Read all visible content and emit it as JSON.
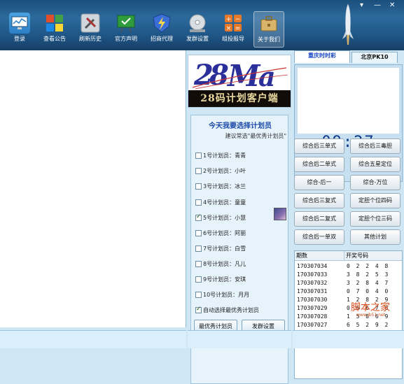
{
  "window_controls": {
    "menu": "▾",
    "minimize": "—",
    "close": "✕"
  },
  "toolbar": {
    "buttons": [
      {
        "label": "登录",
        "icon": "monitor-chart-icon",
        "color": "#2d7fc4"
      },
      {
        "label": "查看公告",
        "icon": "windows-logo-icon",
        "color": "#e04f2a"
      },
      {
        "label": "刷新历史",
        "icon": "tools-icon",
        "color": "#a6a6a6"
      },
      {
        "label": "官方声明",
        "icon": "presentation-board-icon",
        "color": "#2e9b3d"
      },
      {
        "label": "招商代理",
        "icon": "shield-bolt-icon",
        "color": "#3a6fd8"
      },
      {
        "label": "发群设置",
        "icon": "cd-drive-icon",
        "color": "#8a8a8a"
      },
      {
        "label": "组投报导",
        "icon": "calculator-icon",
        "color": "#e6782a"
      },
      {
        "label": "关于我们",
        "icon": "briefcase-icon",
        "color": "#d8b56a"
      }
    ]
  },
  "logo": {
    "main": "28Ma",
    "subtitle": "28码计划客户端"
  },
  "planner": {
    "title": "今天我要选择计划员",
    "hint": "建议常选\"最优秀计划员\"",
    "items": [
      {
        "label": "1号计划员：青青",
        "checked": false
      },
      {
        "label": "2号计划员：小叶",
        "checked": false
      },
      {
        "label": "3号计划员：冰兰",
        "checked": false
      },
      {
        "label": "4号计划员：童童",
        "checked": false
      },
      {
        "label": "5号计划员：小慧",
        "checked": true
      },
      {
        "label": "6号计划员：阿丽",
        "checked": false
      },
      {
        "label": "7号计划员：白雪",
        "checked": false
      },
      {
        "label": "8号计划员：凡儿",
        "checked": false
      },
      {
        "label": "9号计划员：安琪",
        "checked": false
      },
      {
        "label": "10号计划员：月月",
        "checked": false
      }
    ],
    "auto_select": {
      "label": "自动选择最优秀计划员",
      "checked": true
    },
    "best_button": "最优秀计划员",
    "group_button": "发群设置"
  },
  "tabs": [
    {
      "label": "重庆时时彩",
      "active": true
    },
    {
      "label": "北京PK10",
      "active": false
    }
  ],
  "clock": {
    "time": "09:27"
  },
  "plan_buttons": [
    "综合后三单式",
    "综合后三毒胆",
    "综合后二单式",
    "综合五星定位",
    "综合-后一",
    "综合-万位",
    "综合后三复式",
    "定胆个位四码",
    "综合后二复式",
    "定胆个位三码",
    "综合后一单双",
    "其他计划"
  ],
  "draw_table": {
    "headers": [
      "期数",
      "开奖号码"
    ],
    "rows": [
      [
        "170307034",
        "0 2 2 4 8"
      ],
      [
        "170307033",
        "3 8 2 5 3"
      ],
      [
        "170307032",
        "3 2 8 4 7"
      ],
      [
        "170307031",
        "0 7 0 4 0"
      ],
      [
        "170307030",
        "1 2 8 2 9"
      ],
      [
        "170307029",
        "0 6 6 7 6"
      ],
      [
        "170307028",
        "1 5 8 6 9"
      ],
      [
        "170307027",
        "6 5 2 9 2"
      ]
    ]
  },
  "watermark": {
    "text": "脚本之家",
    "url": "www.jb51.net"
  }
}
